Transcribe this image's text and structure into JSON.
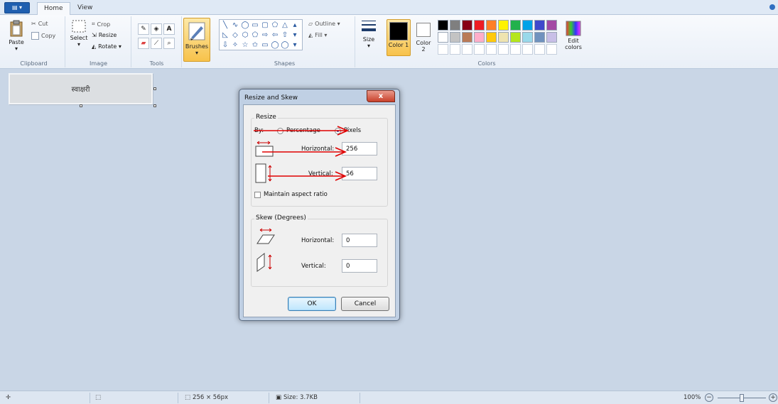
{
  "tabs": {
    "file_label": "▤ ▾",
    "home": "Home",
    "view": "View"
  },
  "clipboard": {
    "paste": "Paste",
    "cut": "Cut",
    "copy": "Copy",
    "group": "Clipboard"
  },
  "image": {
    "select": "Select",
    "crop": "Crop",
    "resize": "Resize",
    "rotate": "Rotate ▾",
    "group": "Image"
  },
  "tools": {
    "group": "Tools",
    "text_tool": "A"
  },
  "brushes": {
    "label": "Brushes"
  },
  "shapes": {
    "outline": "Outline ▾",
    "fill": "Fill ▾",
    "group": "Shapes",
    "glyphs": [
      "╲",
      "∿",
      "◯",
      "▭",
      "▢",
      "⬠",
      "△",
      "▴",
      "◺",
      "◇",
      "⬡",
      "⬠",
      "⇨",
      "⇦",
      "⇧",
      "▾",
      "⇩",
      "✧",
      "☆",
      "✩",
      "▭",
      "◯",
      "◯",
      "▾"
    ]
  },
  "size": {
    "label": "Size"
  },
  "colors": {
    "color1": "Color 1",
    "color2": "Color 2",
    "edit": "Edit colors",
    "group": "Colors",
    "color1_value": "#000000",
    "color2_value": "#ffffff",
    "palette_row1": [
      "#000000",
      "#7f7f7f",
      "#880015",
      "#ed1c24",
      "#ff7f27",
      "#fff200",
      "#22b14c",
      "#00a2e8",
      "#3f48cc",
      "#a349a4"
    ],
    "palette_row2": [
      "#ffffff",
      "#c3c3c3",
      "#b97a57",
      "#ffaec9",
      "#ffc90e",
      "#efe4b0",
      "#b5e61d",
      "#99d9ea",
      "#7092be",
      "#c8bfe7"
    ]
  },
  "canvas": {
    "text": "स्वाक्षरी"
  },
  "dialog": {
    "title": "Resize and Skew",
    "close": "x",
    "resize_legend": "Resize",
    "by": "By:",
    "percentage": "Percentage",
    "pixels": "Pixels",
    "horizontal": "Horizontal:",
    "vertical": "Vertical:",
    "resize_h": "256",
    "resize_v": "56",
    "maintain": "Maintain aspect ratio",
    "skew_legend": "Skew (Degrees)",
    "skew_h": "0",
    "skew_v": "0",
    "ok": "OK",
    "cancel": "Cancel"
  },
  "status": {
    "dimensions": "256 × 56px",
    "size": "Size: 3.7KB",
    "zoom": "100%"
  }
}
